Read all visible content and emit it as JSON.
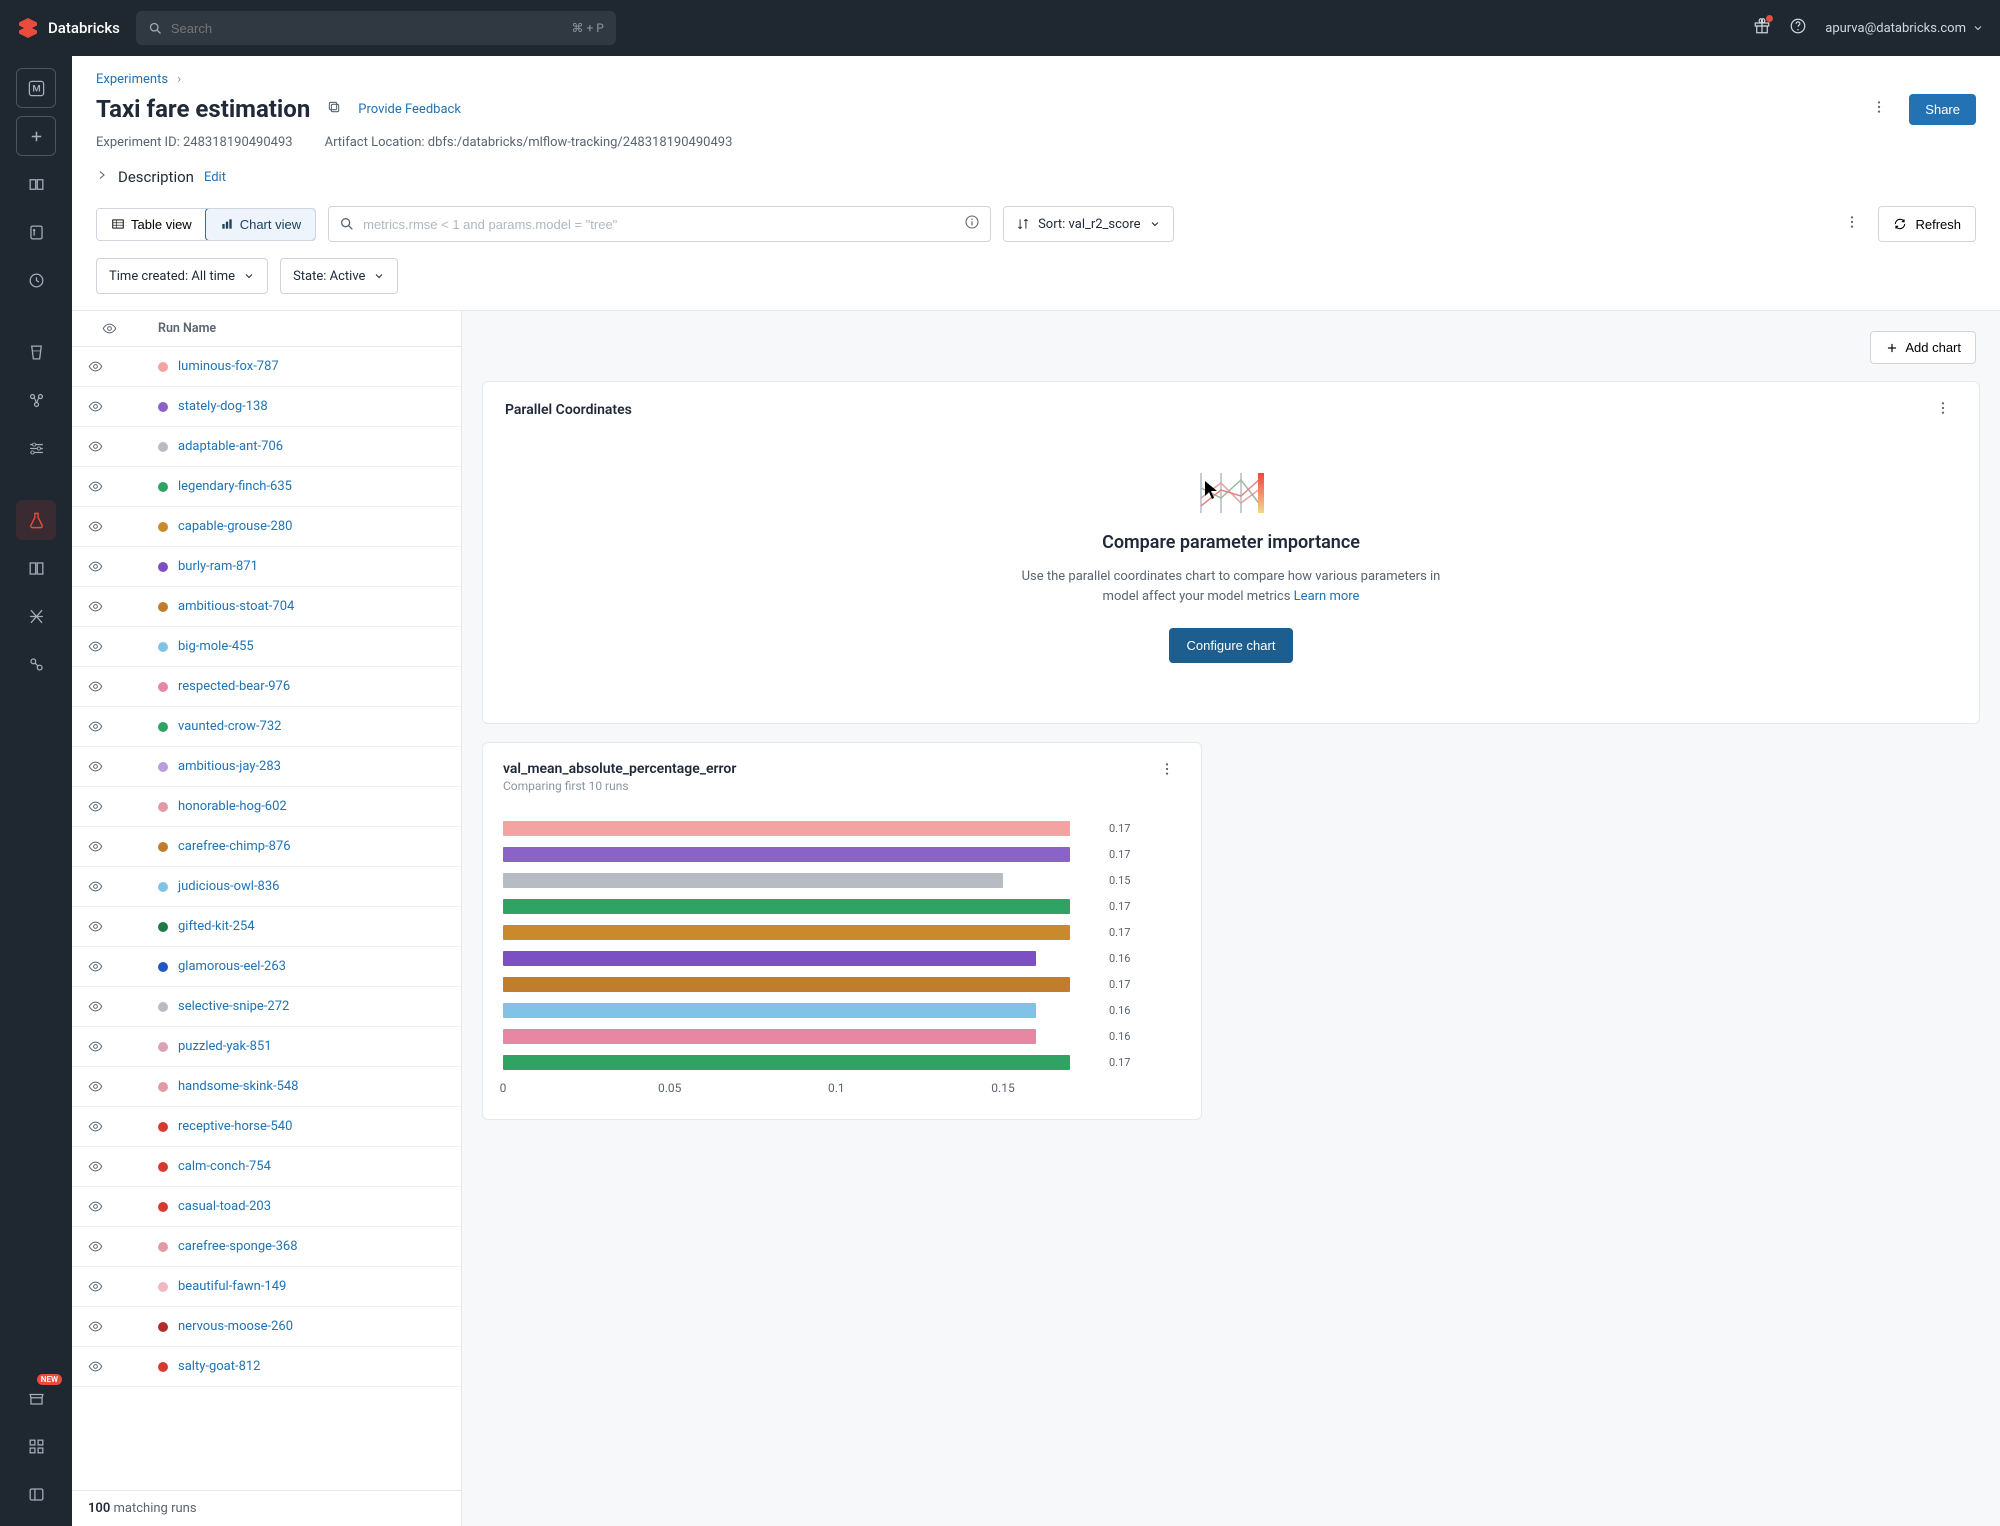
{
  "brand": "Databricks",
  "search": {
    "placeholder": "Search",
    "shortcut": "⌘ + P"
  },
  "user": {
    "email": "apurva@databricks.com"
  },
  "breadcrumb": {
    "root": "Experiments"
  },
  "page": {
    "title": "Taxi fare estimation",
    "feedback": "Provide Feedback",
    "share": "Share",
    "experiment_id_label": "Experiment ID:",
    "experiment_id": "248318190490493",
    "artifact_label": "Artifact Location:",
    "artifact_location": "dbfs:/databricks/mlflow-tracking/248318190490493",
    "description_label": "Description",
    "edit": "Edit"
  },
  "toolbar": {
    "table_view": "Table view",
    "chart_view": "Chart view",
    "filter_placeholder": "metrics.rmse < 1 and params.model = \"tree\"",
    "sort_label": "Sort: val_r2_score",
    "refresh": "Refresh",
    "time_filter": "Time created: All time",
    "state_filter": "State: Active"
  },
  "runs_header": "Run Name",
  "runs_footer_count": "100",
  "runs_footer_text": "matching runs",
  "runs": [
    {
      "name": "luminous-fox-787",
      "color": "#f4a3a3"
    },
    {
      "name": "stately-dog-138",
      "color": "#8a63c9"
    },
    {
      "name": "adaptable-ant-706",
      "color": "#b7bcc3"
    },
    {
      "name": "legendary-finch-635",
      "color": "#2fa363"
    },
    {
      "name": "capable-grouse-280",
      "color": "#c98a2c"
    },
    {
      "name": "burly-ram-871",
      "color": "#7d4fc4"
    },
    {
      "name": "ambitious-stoat-704",
      "color": "#c07d2e"
    },
    {
      "name": "big-mole-455",
      "color": "#7fc4e6"
    },
    {
      "name": "respected-bear-976",
      "color": "#e787a3"
    },
    {
      "name": "vaunted-crow-732",
      "color": "#2fa363"
    },
    {
      "name": "ambitious-jay-283",
      "color": "#b79fe0"
    },
    {
      "name": "honorable-hog-602",
      "color": "#e39aa7"
    },
    {
      "name": "carefree-chimp-876",
      "color": "#c07d2e"
    },
    {
      "name": "judicious-owl-836",
      "color": "#7fc4e6"
    },
    {
      "name": "gifted-kit-254",
      "color": "#1f7a47"
    },
    {
      "name": "glamorous-eel-263",
      "color": "#1f57c4"
    },
    {
      "name": "selective-snipe-272",
      "color": "#b7bcc3"
    },
    {
      "name": "puzzled-yak-851",
      "color": "#d9a2b6"
    },
    {
      "name": "handsome-skink-548",
      "color": "#e39aa7"
    },
    {
      "name": "receptive-horse-540",
      "color": "#d63a2f"
    },
    {
      "name": "calm-conch-754",
      "color": "#d63a2f"
    },
    {
      "name": "casual-toad-203",
      "color": "#d63a2f"
    },
    {
      "name": "carefree-sponge-368",
      "color": "#e39aa7"
    },
    {
      "name": "beautiful-fawn-149",
      "color": "#f0b8c2"
    },
    {
      "name": "nervous-moose-260",
      "color": "#b32c2c"
    },
    {
      "name": "salty-goat-812",
      "color": "#d63a2f"
    }
  ],
  "add_chart": "Add chart",
  "parallel_card": {
    "title": "Parallel Coordinates",
    "heading": "Compare parameter importance",
    "body": "Use the parallel coordinates chart to compare how various parameters in model affect your model metrics",
    "learn": "Learn more",
    "cta": "Configure chart"
  },
  "bar_card": {
    "title": "val_mean_absolute_percentage_error",
    "subtitle": "Comparing first 10 runs"
  },
  "chart_data": {
    "type": "bar",
    "orientation": "horizontal",
    "title": "val_mean_absolute_percentage_error",
    "xlabel": "",
    "ylabel": "",
    "xlim": [
      0,
      0.18
    ],
    "x_ticks": [
      0,
      0.05,
      0.1,
      0.15
    ],
    "bars": [
      {
        "run": "luminous-fox-787",
        "value": 0.17,
        "color": "#f4a3a3"
      },
      {
        "run": "stately-dog-138",
        "value": 0.17,
        "color": "#8a63c9"
      },
      {
        "run": "adaptable-ant-706",
        "value": 0.15,
        "color": "#b7bcc3"
      },
      {
        "run": "legendary-finch-635",
        "value": 0.17,
        "color": "#2fa363"
      },
      {
        "run": "capable-grouse-280",
        "value": 0.17,
        "color": "#c98a2c"
      },
      {
        "run": "burly-ram-871",
        "value": 0.16,
        "color": "#7d4fc4"
      },
      {
        "run": "ambitious-stoat-704",
        "value": 0.17,
        "color": "#c07d2e"
      },
      {
        "run": "big-mole-455",
        "value": 0.16,
        "color": "#7fc4e6"
      },
      {
        "run": "respected-bear-976",
        "value": 0.16,
        "color": "#e787a3"
      },
      {
        "run": "vaunted-crow-732",
        "value": 0.17,
        "color": "#2fa363"
      }
    ]
  },
  "rail_new": "NEW"
}
